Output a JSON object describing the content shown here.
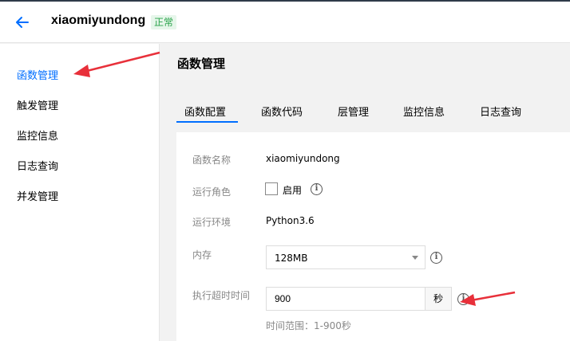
{
  "header": {
    "function_name": "xiaomiyundong",
    "status": "正常"
  },
  "sidebar": {
    "items": [
      {
        "label": "函数管理",
        "active": true
      },
      {
        "label": "触发管理"
      },
      {
        "label": "监控信息"
      },
      {
        "label": "日志查询"
      },
      {
        "label": "并发管理"
      }
    ]
  },
  "main": {
    "title": "函数管理",
    "tabs": [
      {
        "label": "函数配置",
        "active": true
      },
      {
        "label": "函数代码"
      },
      {
        "label": "层管理"
      },
      {
        "label": "监控信息"
      },
      {
        "label": "日志查询"
      }
    ]
  },
  "config": {
    "name_label": "函数名称",
    "name_value": "xiaomiyundong",
    "role_label": "运行角色",
    "role_checkbox_label": "启用",
    "role_enabled": false,
    "env_label": "运行环境",
    "env_value": "Python3.6",
    "memory_label": "内存",
    "memory_value": "128MB",
    "timeout_label": "执行超时时间",
    "timeout_value": "900",
    "timeout_unit": "秒",
    "timeout_hint": "时间范围：1-900秒"
  },
  "colors": {
    "accent": "#006eff",
    "annotation_arrow": "#e8303a",
    "status_green": "#29a34a"
  }
}
